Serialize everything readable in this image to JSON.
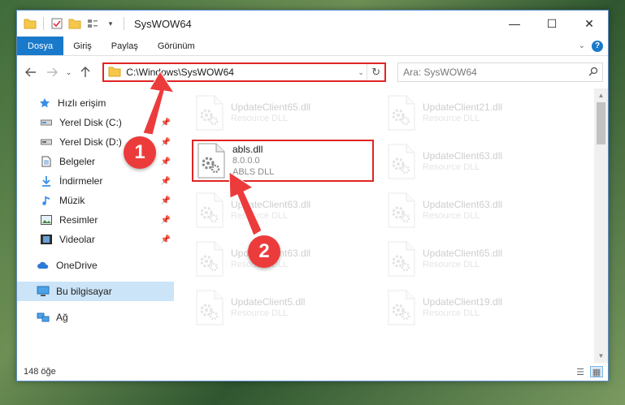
{
  "window": {
    "title": "SysWOW64",
    "controls": {
      "minimize": "—",
      "maximize": "☐",
      "close": "✕"
    }
  },
  "ribbon": {
    "tabs": [
      {
        "label": "Dosya",
        "active": true
      },
      {
        "label": "Giriş",
        "active": false
      },
      {
        "label": "Paylaş",
        "active": false
      },
      {
        "label": "Görünüm",
        "active": false
      }
    ],
    "expand_icon": "chevron-down-icon",
    "help_label": "?"
  },
  "navbar": {
    "address_path": "C:\\Windows\\SysWOW64",
    "search_placeholder": "Ara: SysWOW64"
  },
  "sidebar": {
    "items": [
      {
        "label": "Hızlı erişim",
        "icon": "star-icon",
        "pinned": false
      },
      {
        "label": "Yerel Disk (C:)",
        "icon": "drive-icon",
        "pinned": true
      },
      {
        "label": "Yerel Disk (D:)",
        "icon": "drive-icon",
        "pinned": true
      },
      {
        "label": "Belgeler",
        "icon": "documents-icon",
        "pinned": true
      },
      {
        "label": "İndirmeler",
        "icon": "download-icon",
        "pinned": true
      },
      {
        "label": "Müzik",
        "icon": "music-icon",
        "pinned": true
      },
      {
        "label": "Resimler",
        "icon": "pictures-icon",
        "pinned": true
      },
      {
        "label": "Videolar",
        "icon": "videos-icon",
        "pinned": true
      },
      {
        "label": "OneDrive",
        "icon": "cloud-icon",
        "pinned": false
      },
      {
        "label": "Bu bilgisayar",
        "icon": "computer-icon",
        "pinned": false,
        "selected": true
      },
      {
        "label": "Ağ",
        "icon": "network-icon",
        "pinned": false
      }
    ]
  },
  "files": [
    {
      "name": "UpdateClient65.dll",
      "type": "Resource DLL",
      "faded": true
    },
    {
      "name": "UpdateClient21.dll",
      "type": "Resource DLL",
      "faded": true
    },
    {
      "name": "abls.dll",
      "version": "8.0.0.0",
      "type": "ABLS DLL",
      "faded": false,
      "highlighted": true
    },
    {
      "name": "UpdateClient63.dll",
      "type": "Resource DLL",
      "faded": true
    },
    {
      "name": "UpdateClient63.dll",
      "type": "Resource DLL",
      "faded": true
    },
    {
      "name": "UpdateClient63.dll",
      "type": "Resource DLL",
      "faded": true
    },
    {
      "name": "UpdateClient63.dll",
      "type": "Resource DLL",
      "faded": true
    },
    {
      "name": "UpdateClient65.dll",
      "type": "Resource DLL",
      "faded": true
    },
    {
      "name": "UpdateClient5.dll",
      "type": "Resource DLL",
      "faded": true
    },
    {
      "name": "UpdateClient19.dll",
      "type": "Resource DLL",
      "faded": true
    }
  ],
  "status": {
    "item_count": "148 öğe"
  },
  "annotations": [
    {
      "label": "1",
      "color": "#ec3b3b"
    },
    {
      "label": "2",
      "color": "#ec3b3b"
    }
  ]
}
